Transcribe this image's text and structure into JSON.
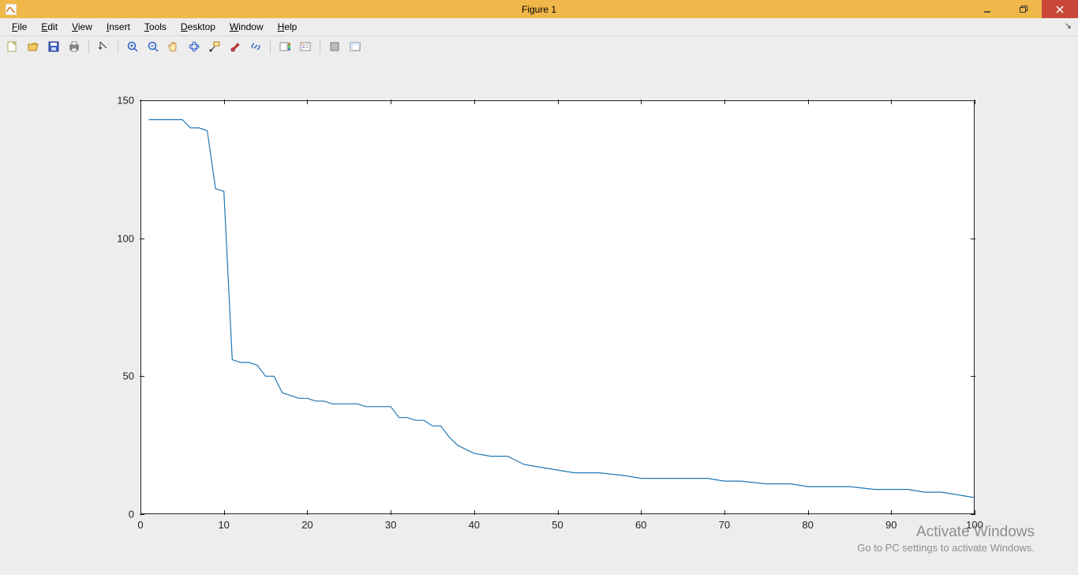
{
  "window": {
    "title": "Figure 1"
  },
  "menus": {
    "file": {
      "label": "File",
      "accel": "F"
    },
    "edit": {
      "label": "Edit",
      "accel": "E"
    },
    "view": {
      "label": "View",
      "accel": "V"
    },
    "insert": {
      "label": "Insert",
      "accel": "I"
    },
    "tools": {
      "label": "Tools",
      "accel": "T"
    },
    "desktop": {
      "label": "Desktop",
      "accel": "D"
    },
    "window": {
      "label": "Window",
      "accel": "W"
    },
    "help": {
      "label": "Help",
      "accel": "H"
    }
  },
  "toolbar_icons": {
    "new": "new-figure-icon",
    "open": "open-icon",
    "save": "save-icon",
    "print": "print-icon",
    "edit_plot": "edit-plot-arrow-icon",
    "zoom_in": "zoom-in-icon",
    "zoom_out": "zoom-out-icon",
    "pan": "pan-hand-icon",
    "rotate": "rotate-3d-icon",
    "data_cursor": "data-cursor-icon",
    "brush": "brush-icon",
    "link": "link-plots-icon",
    "colorbar": "insert-colorbar-icon",
    "legend": "insert-legend-icon",
    "hide": "hide-plot-tools-icon",
    "show": "show-plot-tools-icon"
  },
  "watermark": {
    "line1": "Activate Windows",
    "line2": "Go to PC settings to activate Windows."
  },
  "chart_data": {
    "type": "line",
    "color": "#1f77b4",
    "xlabel": "",
    "ylabel": "",
    "xlim": [
      0,
      100
    ],
    "ylim": [
      0,
      150
    ],
    "xticks": [
      0,
      10,
      20,
      30,
      40,
      50,
      60,
      70,
      80,
      90,
      100
    ],
    "yticks": [
      0,
      50,
      100,
      150
    ],
    "x": [
      1,
      2,
      3,
      4,
      5,
      6,
      7,
      8,
      9,
      10,
      11,
      12,
      13,
      14,
      15,
      16,
      17,
      18,
      19,
      20,
      21,
      22,
      23,
      24,
      25,
      26,
      27,
      28,
      29,
      30,
      31,
      32,
      33,
      34,
      35,
      36,
      37,
      38,
      40,
      42,
      44,
      46,
      48,
      50,
      52,
      55,
      58,
      60,
      62,
      65,
      68,
      70,
      72,
      75,
      78,
      80,
      82,
      85,
      88,
      90,
      92,
      94,
      95,
      96,
      98,
      100
    ],
    "y": [
      143,
      143,
      143,
      143,
      143,
      140,
      140,
      139,
      118,
      117,
      56,
      55,
      55,
      54,
      50,
      50,
      44,
      43,
      42,
      42,
      41,
      41,
      40,
      40,
      40,
      40,
      39,
      39,
      39,
      39,
      35,
      35,
      34,
      34,
      32,
      32,
      28,
      25,
      22,
      21,
      21,
      18,
      17,
      16,
      15,
      15,
      14,
      13,
      13,
      13,
      13,
      12,
      12,
      11,
      11,
      10,
      10,
      10,
      9,
      9,
      9,
      8,
      8,
      8,
      7,
      6
    ]
  }
}
